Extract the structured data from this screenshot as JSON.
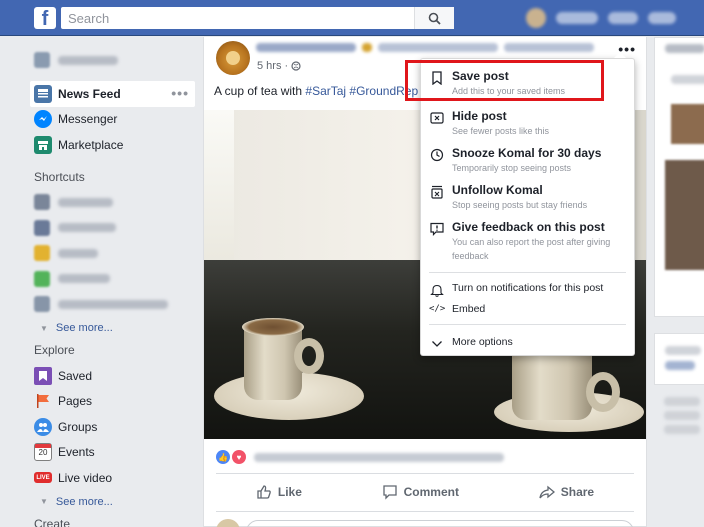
{
  "topbar": {
    "search_placeholder": "Search",
    "logo": "f"
  },
  "sidebar": {
    "items": [
      {
        "label": "News Feed",
        "icon": "news-feed-icon"
      },
      {
        "label": "Messenger",
        "icon": "messenger-icon"
      },
      {
        "label": "Marketplace",
        "icon": "marketplace-icon"
      }
    ],
    "more_dots": "•••",
    "shortcuts_heading": "Shortcuts",
    "see_more_1": "See more...",
    "explore_heading": "Explore",
    "explore_items": [
      {
        "label": "Saved",
        "icon": "saved-icon"
      },
      {
        "label": "Pages",
        "icon": "pages-flag-icon"
      },
      {
        "label": "Groups",
        "icon": "groups-icon"
      },
      {
        "label": "Events",
        "icon": "events-calendar-icon",
        "badge": "20"
      },
      {
        "label": "Live video",
        "icon": "live-video-icon",
        "badge": "LIVE"
      }
    ],
    "see_more_2": "See more...",
    "create_heading": "Create"
  },
  "post": {
    "time": "5 hrs · ",
    "more_dots": "•••",
    "text_prefix": "A cup of tea with ",
    "tag1": "#SarTaj",
    "tag2": "#GroundRep",
    "actions": {
      "like": "Like",
      "comment": "Comment",
      "share": "Share"
    }
  },
  "menu": {
    "items": [
      {
        "title": "Save post",
        "subtitle": "Add this to your saved items",
        "icon": "bookmark-icon"
      },
      {
        "title": "Hide post",
        "subtitle": "See fewer posts like this",
        "icon": "hide-x-box-icon"
      },
      {
        "title": "Snooze Komal for 30 days",
        "subtitle": "Temporarily stop seeing posts",
        "icon": "clock-icon"
      },
      {
        "title": "Unfollow Komal",
        "subtitle": "Stop seeing posts but stay friends",
        "icon": "unfollow-icon"
      },
      {
        "title": "Give feedback on this post",
        "subtitle_line1": "You can also report the post after giving",
        "subtitle_line2": "feedback",
        "icon": "feedback-exclamation-icon"
      }
    ],
    "notifications": "Turn on notifications for this post",
    "embed": "Embed",
    "embed_glyph": "</>",
    "more_options": "More options"
  },
  "colors": {
    "topbar": "#4267b2",
    "link": "#365899",
    "highlight": "#e0161b"
  }
}
